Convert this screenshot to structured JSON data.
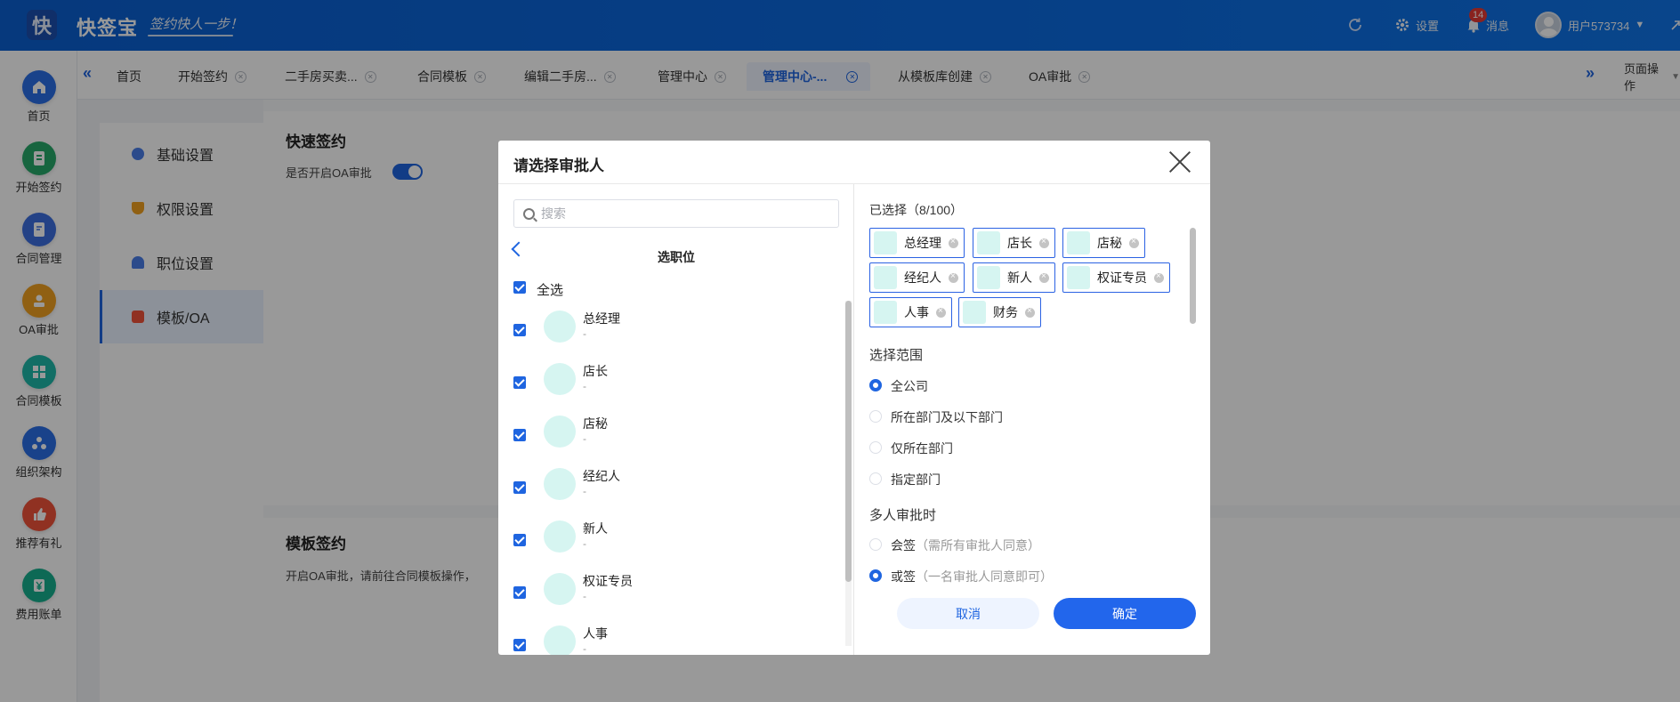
{
  "header": {
    "logo_text": "快",
    "brand": "快签宝",
    "slogan": "签约快人一步！",
    "settings_label": "设置",
    "messages_label": "消息",
    "messages_count": "14",
    "user_name": "用户573734"
  },
  "leftnav": {
    "items": [
      {
        "label": "首页",
        "color": "#2a6ee6"
      },
      {
        "label": "开始签约",
        "color": "#27a86a"
      },
      {
        "label": "合同管理",
        "color": "#3d6fe0"
      },
      {
        "label": "OA审批",
        "color": "#f0a020"
      },
      {
        "label": "合同模板",
        "color": "#1fb8a8"
      },
      {
        "label": "组织架构",
        "color": "#2a6ee6"
      },
      {
        "label": "推荐有礼",
        "color": "#f0523a"
      },
      {
        "label": "费用账单",
        "color": "#17b08e"
      }
    ]
  },
  "tabs": {
    "items": [
      {
        "label": "首页",
        "closable": false
      },
      {
        "label": "开始签约",
        "closable": true
      },
      {
        "label": "二手房买卖...",
        "closable": true
      },
      {
        "label": "合同模板",
        "closable": true
      },
      {
        "label": "编辑二手房...",
        "closable": true
      },
      {
        "label": "管理中心",
        "closable": true
      },
      {
        "label": "管理中心-...",
        "closable": true,
        "active": true
      },
      {
        "label": "从模板库创建",
        "closable": true
      },
      {
        "label": "OA审批",
        "closable": true
      }
    ],
    "page_actions": "页面操作"
  },
  "settings_nav": {
    "items": [
      {
        "label": "基础设置",
        "icon": "gear-icon",
        "color": "#4a7ee8"
      },
      {
        "label": "权限设置",
        "icon": "shield-icon",
        "color": "#f0a020"
      },
      {
        "label": "职位设置",
        "icon": "person-icon",
        "color": "#4a7ee8"
      },
      {
        "label": "模板/OA",
        "icon": "template-icon",
        "color": "#f0523a",
        "active": true
      }
    ]
  },
  "content": {
    "quick_sign": {
      "title": "快速签约",
      "toggle_label": "是否开启OA审批"
    },
    "template_sign": {
      "title": "模板签约",
      "text": "开启OA审批，请前往合同模板操作，"
    }
  },
  "modal": {
    "title": "请选择审批人",
    "search_placeholder": "搜索",
    "list_title": "选职位",
    "select_all_label": "全选",
    "positions": [
      {
        "name": "总经理",
        "sub": "-"
      },
      {
        "name": "店长",
        "sub": "-"
      },
      {
        "name": "店秘",
        "sub": "-"
      },
      {
        "name": "经纪人",
        "sub": "-"
      },
      {
        "name": "新人",
        "sub": "-"
      },
      {
        "name": "权证专员",
        "sub": "-"
      },
      {
        "name": "人事",
        "sub": "-"
      }
    ],
    "selected_label": "已选择（8/100）",
    "selected": [
      "总经理",
      "店长",
      "店秘",
      "经纪人",
      "新人",
      "权证专员",
      "人事",
      "财务"
    ],
    "scope_title": "选择范围",
    "scope_options": [
      {
        "label": "全公司",
        "checked": true
      },
      {
        "label": "所在部门及以下部门",
        "checked": false
      },
      {
        "label": "仅所在部门",
        "checked": false
      },
      {
        "label": "指定部门",
        "checked": false
      }
    ],
    "multi_title": "多人审批时",
    "multi_options": [
      {
        "label": "会签",
        "hint": "（需所有审批人同意）",
        "checked": false
      },
      {
        "label": "或签",
        "hint": "（一名审批人同意即可）",
        "checked": true
      }
    ],
    "cancel_label": "取消",
    "confirm_label": "确定"
  }
}
